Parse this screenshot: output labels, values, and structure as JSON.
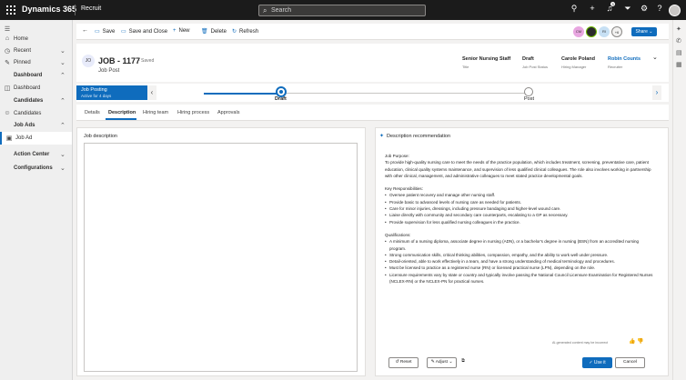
{
  "topbar": {
    "brand": "Dynamics 365",
    "app": "Recruit",
    "search_placeholder": "Search",
    "notification_count": "3"
  },
  "nav": {
    "items": [
      {
        "label": "Home"
      },
      {
        "label": "Recent"
      },
      {
        "label": "Pinned"
      }
    ],
    "sections": [
      {
        "label": "Dashboard",
        "items": [
          "Dashboard"
        ]
      },
      {
        "label": "Candidates",
        "items": [
          "Candidates"
        ]
      },
      {
        "label": "Job Ads",
        "items": [
          "Job Ad"
        ]
      },
      {
        "label": "Action Center",
        "items": []
      },
      {
        "label": "Configurations",
        "items": []
      }
    ]
  },
  "commands": {
    "save": "Save",
    "save_close": "Save and Close",
    "new": "New",
    "delete": "Delete",
    "refresh": "Refresh",
    "share": "Share"
  },
  "collaborators": [
    "CM",
    "",
    "RI",
    "+6"
  ],
  "record": {
    "initials": "JO",
    "title": "JOB - 1177",
    "status": "- Saved",
    "entity": "Job Post",
    "fields": [
      {
        "value": "Senior Nursing Staff",
        "label": "Title"
      },
      {
        "value": "Draft",
        "label": "Job Post Status"
      },
      {
        "value": "Carole Poland",
        "label": "Hiring Manager"
      },
      {
        "value": "Robin Counts",
        "label": "Recruiter"
      }
    ]
  },
  "bpf": {
    "stage_name": "Job Posting",
    "stage_duration": "Active for 4 days",
    "stages": [
      "Draft",
      "Post"
    ]
  },
  "tabs": [
    "Details",
    "Description",
    "Hiring team",
    "Hiring process",
    "Approvals"
  ],
  "selected_tab": "Description",
  "left_panel": {
    "label": "Job description"
  },
  "recommendation": {
    "header": "Description recommendation",
    "purpose_heading": "Job Purpose:",
    "purpose_text": "To provide high-quality nursing care to meet the needs of the practice population, which includes treatment, screening, preventative care, patient education, clinical quality systems maintenance, and supervision of less qualified clinical colleagues. The role also involves working in partnership with other clinical, management, and administrative colleagues to meet stated practice developmental goals.",
    "resp_heading": "Key Responsibilities:",
    "responsibilities": [
      "Oversee patient recovery and manage other nursing staff.",
      "Provide basic to advanced levels of nursing care as needed for patients.",
      "Care for minor injuries, dressings, including pressure bandaging and higher-level wound care.",
      "Liaise directly with community and secondary care counterparts, escalating to a GP as necessary.",
      "Provide supervision for less qualified nursing colleagues in the practice."
    ],
    "qual_heading": "Qualifications:",
    "qualifications": [
      "A minimum of a nursing diploma, associate degree in nursing (ADN), or a bachelor's degree in nursing (BSN) from an accredited nursing program.",
      "Strong communication skills, critical thinking abilities, compassion, empathy, and the ability to work well under pressure.",
      "Detail-oriented, able to work effectively in a team, and have a strong understanding of medical terminology and procedures.",
      "Must be licensed to practice as a registered nurse (RN) or licensed practical nurse (LPN), depending on the role.",
      "Licensure requirements vary by state or country and typically involve passing the National Council Licensure Examination for Registered Nurses (NCLEX-RN) or the NCLEX-PN for practical nurses."
    ],
    "disclaimer": "AI-generated content may be incorrect",
    "reset": "Reset",
    "adjust": "Adjust",
    "use_it": "Use it",
    "cancel": "Cancel"
  }
}
